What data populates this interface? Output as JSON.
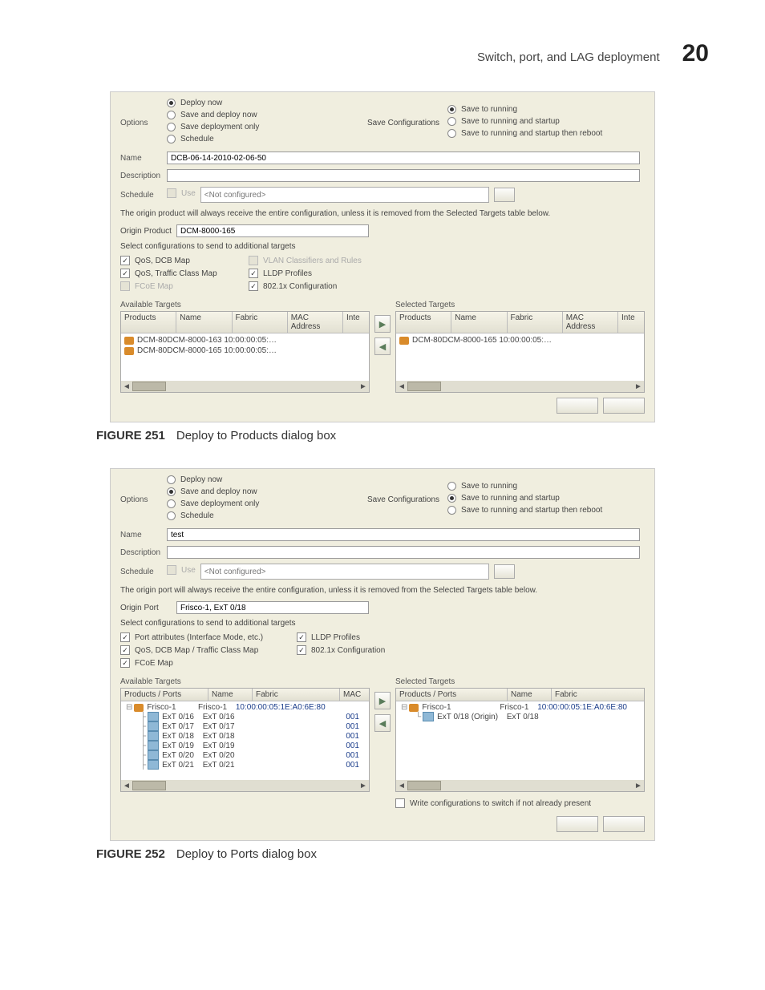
{
  "header": {
    "title": "Switch, port, and LAG deployment",
    "chapter": "20"
  },
  "fig251": {
    "label": "FIGURE 251",
    "caption": "Deploy to Products dialog box"
  },
  "fig252": {
    "label": "FIGURE 252",
    "caption": "Deploy to Ports dialog box"
  },
  "d1": {
    "labels": {
      "options": "Options",
      "saveConfig": "Save Configurations",
      "name": "Name",
      "description": "Description",
      "schedule": "Schedule",
      "origin": "Origin Product",
      "useHint": "Use"
    },
    "options": {
      "deployNow": "Deploy now",
      "saveDeploy": "Save and deploy now",
      "saveOnly": "Save deployment only",
      "schedule": "Schedule"
    },
    "saveOpts": {
      "running": "Save to running",
      "runStartup": "Save to running and startup",
      "runStartupReboot": "Save to running and startup then reboot"
    },
    "name": "DCB-06-14-2010-02-06-50",
    "schedHint": "<Not configured>",
    "note": "The origin product will always receive the entire configuration, unless it is removed from the Selected Targets table below.",
    "originValue": "DCM-8000-165",
    "subhead": "Select configurations to send to additional targets",
    "cfg": {
      "qosDcb": "QoS, DCB Map",
      "qosTraffic": "QoS, Traffic Class Map",
      "fcoe": "FCoE Map",
      "vlan": "VLAN Classifiers and Rules",
      "lldp": "LLDP Profiles",
      "dot1x": "802.1x Configuration"
    },
    "availTitle": "Available Targets",
    "selTitle": "Selected Targets",
    "cols": {
      "products": "Products",
      "name": "Name",
      "fabric": "Fabric",
      "mac": "MAC Address",
      "inte": "Inte"
    },
    "availRows": [
      {
        "name": "DCM-80DCM-8000-163",
        "mac": "10:00:00:05:…"
      },
      {
        "name": "DCM-80DCM-8000-165",
        "mac": "10:00:00:05:…"
      }
    ],
    "selRows": [
      {
        "name": "DCM-80DCM-8000-165",
        "mac": "10:00:00:05:…"
      }
    ]
  },
  "d2": {
    "labels": {
      "options": "Options",
      "saveConfig": "Save Configurations",
      "name": "Name",
      "description": "Description",
      "schedule": "Schedule",
      "origin": "Origin Port",
      "useHint": "Use"
    },
    "options": {
      "deployNow": "Deploy now",
      "saveDeploy": "Save and deploy now",
      "saveOnly": "Save deployment only",
      "schedule": "Schedule"
    },
    "saveOpts": {
      "running": "Save to running",
      "runStartup": "Save to running and startup",
      "runStartupReboot": "Save to running and startup then reboot"
    },
    "name": "test",
    "schedHint": "<Not configured>",
    "note": "The origin port will always receive the entire configuration, unless it is removed from the Selected Targets table below.",
    "originValue": "Frisco-1, ExT 0/18",
    "subhead": "Select configurations to send to additional targets",
    "cfg": {
      "portAttr": "Port attributes (Interface Mode, etc.)",
      "lldp": "LLDP Profiles",
      "qos": "QoS, DCB Map / Traffic Class Map",
      "dot1x": "802.1x Configuration",
      "fcoe": "FCoE Map"
    },
    "availTitle": "Available Targets",
    "selTitle": "Selected Targets",
    "cols": {
      "pp": "Products / Ports",
      "name": "Name",
      "fabric": "Fabric",
      "mac": "MAC"
    },
    "availTree": {
      "root": {
        "label": "Frisco-1",
        "fabric": "Frisco-1",
        "mac": "10:00:00:05:1E:A0:6E:80"
      },
      "children": [
        {
          "label": "ExT 0/16",
          "name": "ExT 0/16",
          "mac": "001"
        },
        {
          "label": "ExT 0/17",
          "name": "ExT 0/17",
          "mac": "001"
        },
        {
          "label": "ExT 0/18",
          "name": "ExT 0/18",
          "mac": "001"
        },
        {
          "label": "ExT 0/19",
          "name": "ExT 0/19",
          "mac": "001"
        },
        {
          "label": "ExT 0/20",
          "name": "ExT 0/20",
          "mac": "001"
        },
        {
          "label": "ExT 0/21",
          "name": "ExT 0/21",
          "mac": "001"
        }
      ]
    },
    "selTree": {
      "root": {
        "label": "Frisco-1",
        "fabric": "Frisco-1",
        "mac": "10:00:00:05:1E:A0:6E:80"
      },
      "children": [
        {
          "label": "ExT 0/18 (Origin)",
          "name": "ExT 0/18"
        }
      ]
    },
    "writeCfg": "Write configurations to switch if not already present"
  }
}
